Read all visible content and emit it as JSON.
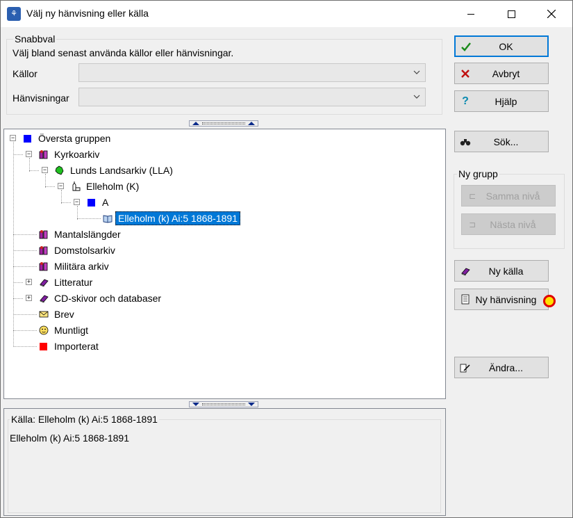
{
  "window": {
    "title": "Välj ny hänvisning eller källa",
    "app_icon": "tree-icon"
  },
  "snabbval": {
    "title": "Snabbval",
    "description": "Välj bland senast använda källor eller hänvisningar.",
    "kallor_label": "Källor",
    "kallor_value": "",
    "hanvisningar_label": "Hänvisningar",
    "hanvisningar_value": ""
  },
  "tree": {
    "items": [
      {
        "label": "Översta gruppen",
        "icon": "blue-square-icon",
        "expander": "minus"
      },
      {
        "label": "Kyrkoarkiv",
        "icon": "books-icon",
        "expander": "minus"
      },
      {
        "label": "Lunds Landsarkiv (LLA)",
        "icon": "green-map-icon",
        "expander": "minus"
      },
      {
        "label": "Elleholm (K)",
        "icon": "church-icon",
        "expander": "minus"
      },
      {
        "label": "A",
        "icon": "blue-square-icon",
        "expander": "minus"
      },
      {
        "label": "Elleholm (k) Ai:5 1868-1891",
        "icon": "open-book-icon",
        "expander": "",
        "selected": true
      },
      {
        "label": "Mantalslängder",
        "icon": "books-icon",
        "expander": ""
      },
      {
        "label": "Domstolsarkiv",
        "icon": "books-icon",
        "expander": ""
      },
      {
        "label": "Militära arkiv",
        "icon": "books-icon",
        "expander": ""
      },
      {
        "label": "Litteratur",
        "icon": "book-icon",
        "expander": "plus"
      },
      {
        "label": "CD-skivor och databaser",
        "icon": "book-icon",
        "expander": "plus"
      },
      {
        "label": "Brev",
        "icon": "envelope-icon",
        "expander": ""
      },
      {
        "label": "Muntligt",
        "icon": "face-icon",
        "expander": ""
      },
      {
        "label": "Importerat",
        "icon": "red-square-icon",
        "expander": ""
      }
    ]
  },
  "info": {
    "group_title": "Källa: Elleholm (k) Ai:5 1868-1891",
    "text": "Elleholm (k) Ai:5 1868-1891"
  },
  "buttons": {
    "ok": "OK",
    "avbryt": "Avbryt",
    "hjalp": "Hjälp",
    "sok": "Sök...",
    "ny_grupp_title": "Ny grupp",
    "samma_niva": "Samma nivå",
    "nasta_niva": "Nästa nivå",
    "ny_kalla": "Ny källa",
    "ny_hanvisning": "Ny hänvisning",
    "andra": "Ändra..."
  },
  "colors": {
    "selection": "#0078d7",
    "cursor_highlight_fill": "#ffe000",
    "cursor_highlight_ring": "#e00000"
  }
}
